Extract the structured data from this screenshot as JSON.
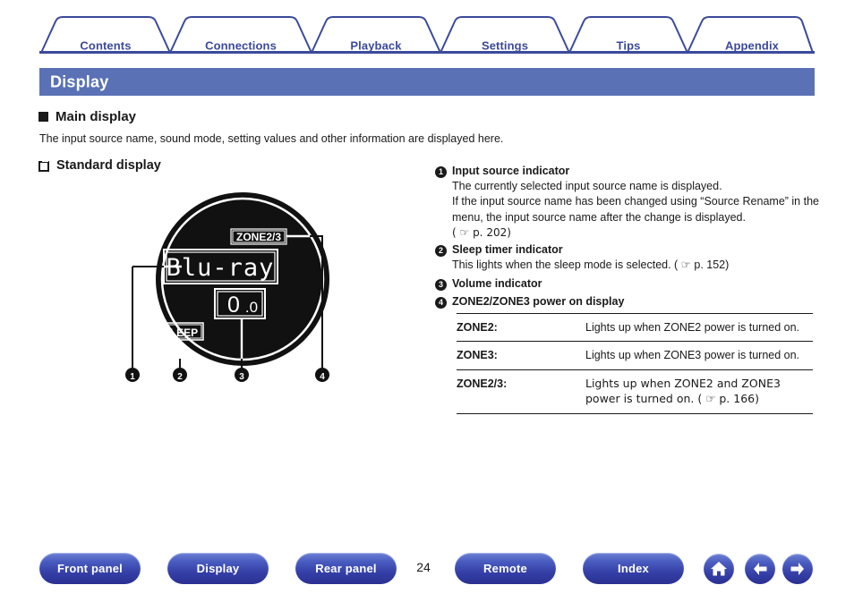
{
  "tabs": [
    {
      "label": "Contents"
    },
    {
      "label": "Connections"
    },
    {
      "label": "Playback"
    },
    {
      "label": "Settings"
    },
    {
      "label": "Tips"
    },
    {
      "label": "Appendix"
    }
  ],
  "banner": {
    "title": "Display"
  },
  "sections": {
    "main_display_heading": "Main display",
    "intro": "The input source name, sound mode, setting values and other information are displayed here.",
    "standard_display_heading": "Standard display"
  },
  "figure": {
    "source_name": "Blu-ray",
    "volume": "0.0",
    "volume_int": "0",
    "volume_frac": ".0",
    "sleep_label": "SLEEP",
    "zone_label": "ZONE2/3",
    "callouts": [
      "1",
      "2",
      "3",
      "4"
    ]
  },
  "callouts": [
    {
      "num": "1",
      "title": "Input source indicator",
      "lines": [
        "The currently selected input source name is displayed.",
        "If the input source name has been changed using “Source Rename” in the menu, the input source name after the change is displayed."
      ],
      "ref": "( ☞ p. 202)"
    },
    {
      "num": "2",
      "title": "Sleep timer indicator",
      "lines": [
        "This lights when the sleep mode is selected.  ( ☞ p. 152)"
      ],
      "ref": ""
    },
    {
      "num": "3",
      "title": "Volume indicator",
      "lines": [],
      "ref": ""
    },
    {
      "num": "4",
      "title": "ZONE2/ZONE3 power on display",
      "lines": [],
      "ref": ""
    }
  ],
  "zone_table": {
    "rows": [
      {
        "key": "ZONE2:",
        "desc": "Lights up when ZONE2 power is turned on."
      },
      {
        "key": "ZONE3:",
        "desc": "Lights up when ZONE3 power is turned on."
      },
      {
        "key": "ZONE2/3:",
        "desc": "Lights up when ZONE2 and ZONE3 power is turned on.  ( ☞ p. 166)"
      }
    ]
  },
  "footer": {
    "buttons": [
      {
        "label": "Front panel"
      },
      {
        "label": "Display"
      },
      {
        "label": "Rear panel"
      },
      {
        "label": "Remote"
      },
      {
        "label": "Index"
      }
    ],
    "page_number": "24",
    "icons": [
      {
        "name": "home-icon"
      },
      {
        "name": "arrow-left-icon"
      },
      {
        "name": "arrow-right-icon"
      }
    ]
  },
  "colors": {
    "banner_blue": "#5a72b5",
    "tab_text": "#3b4a9c",
    "button_blue": "#3540a8"
  }
}
